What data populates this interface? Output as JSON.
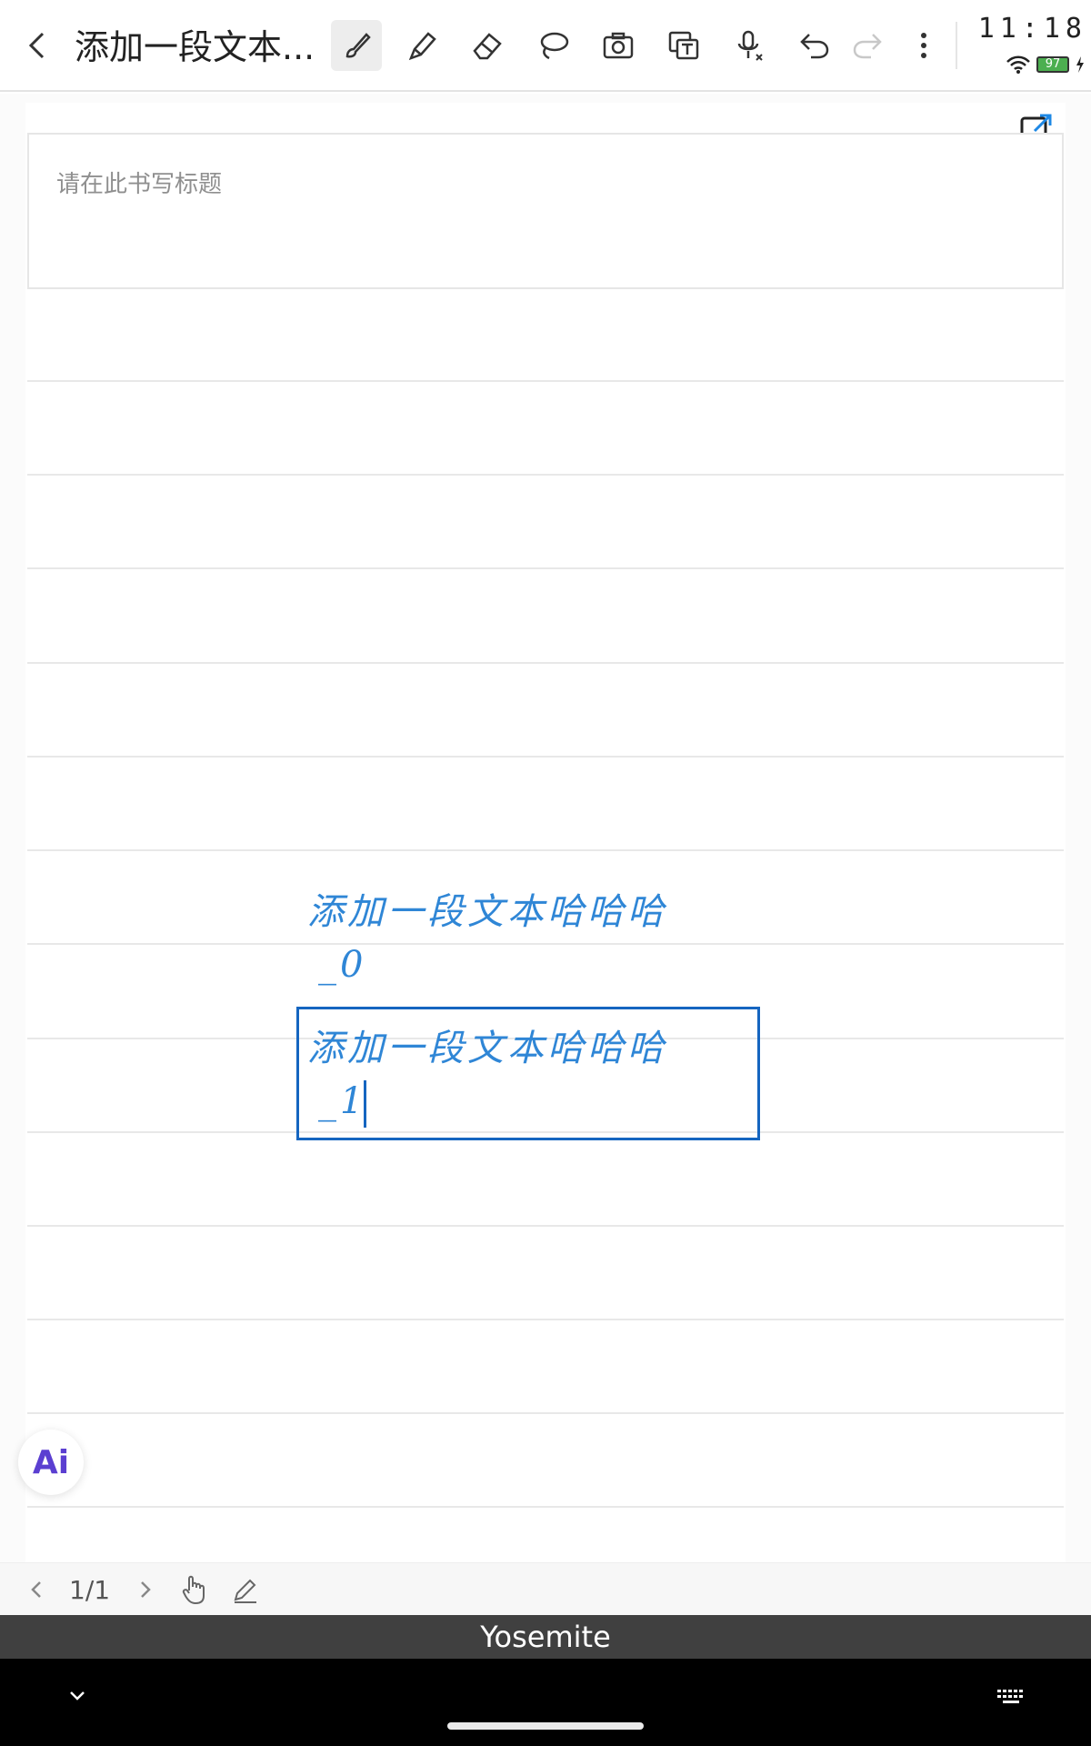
{
  "header": {
    "title": "添加一段文本...",
    "tools": [
      {
        "name": "brush-tool",
        "icon": "brush-icon",
        "active": true
      },
      {
        "name": "marker-tool",
        "icon": "marker-icon"
      },
      {
        "name": "eraser-tool",
        "icon": "eraser-icon"
      },
      {
        "name": "lasso-tool",
        "icon": "lasso-icon"
      },
      {
        "name": "camera-tool",
        "icon": "camera-icon"
      },
      {
        "name": "text-tool",
        "icon": "text-box-icon"
      },
      {
        "name": "voice-tool",
        "icon": "microphone-icon"
      },
      {
        "name": "undo-button",
        "icon": "undo-icon"
      },
      {
        "name": "redo-button",
        "icon": "redo-icon",
        "disabled": true
      },
      {
        "name": "more-button",
        "icon": "more-vertical-icon"
      }
    ]
  },
  "status": {
    "time": "11:18",
    "battery": "97",
    "wifi": "wifi-icon"
  },
  "note": {
    "title_placeholder": "请在此书写标题",
    "handwriting": [
      "添加一段文本哈哈哈",
      "_0",
      "添加一段文本哈哈哈",
      "_1"
    ]
  },
  "ai_button": {
    "label": "Ai"
  },
  "page_nav": {
    "indicator": "1/1"
  },
  "keyboard_bar": {
    "label": "Yosemite"
  },
  "colors": {
    "accent": "#1565c0",
    "ink": "#2f86d6"
  }
}
